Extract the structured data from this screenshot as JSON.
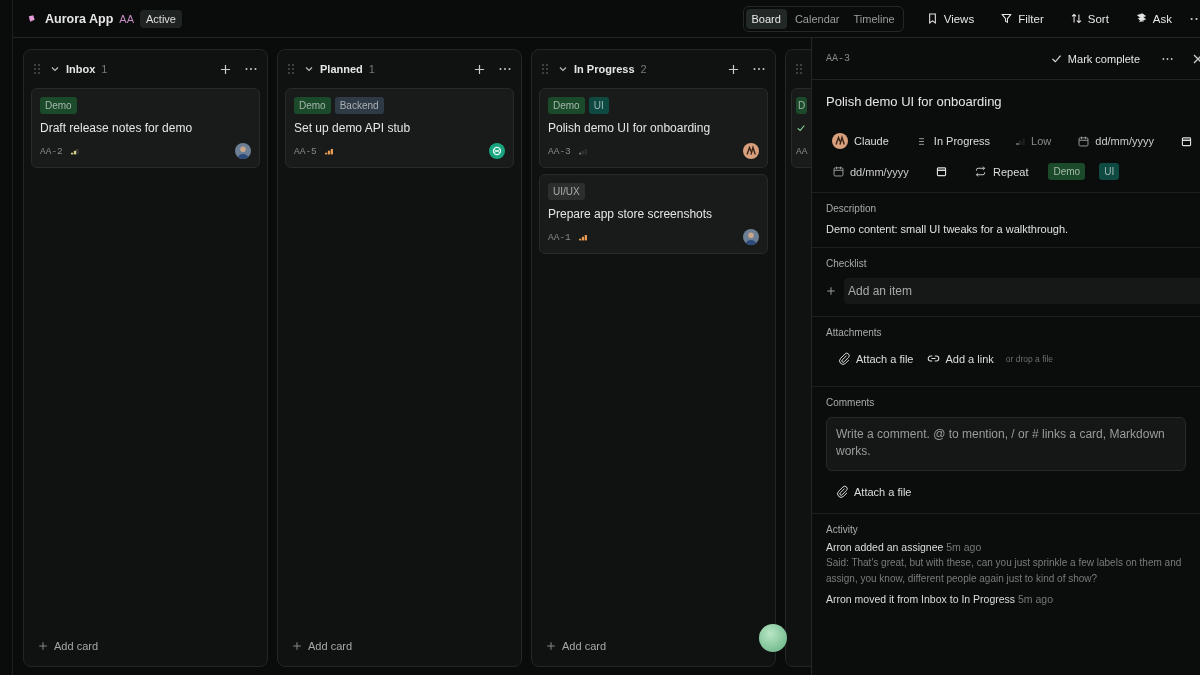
{
  "app": {
    "name": "Aurora App",
    "initials": "AA",
    "status": "Active"
  },
  "view_tabs": [
    {
      "label": "Board",
      "selected": true
    },
    {
      "label": "Calendar",
      "selected": false
    },
    {
      "label": "Timeline",
      "selected": false
    }
  ],
  "toolbar": [
    {
      "label": "Views"
    },
    {
      "label": "Filter"
    },
    {
      "label": "Sort"
    },
    {
      "label": "Ask"
    }
  ],
  "columns": [
    {
      "title": "Inbox",
      "count": "1",
      "add_label": "Add card",
      "cards": [
        {
          "tags": [
            {
              "label": "Demo",
              "color": "#1b4a2b"
            }
          ],
          "title": "Draft release notes for demo",
          "id": "AA-2",
          "priority": {
            "kind": "medium"
          },
          "avatar": {
            "kind": "person"
          }
        }
      ]
    },
    {
      "title": "Planned",
      "count": "1",
      "add_label": "Add card",
      "cards": [
        {
          "tags": [
            {
              "label": "Demo",
              "color": "#1b4a2b"
            },
            {
              "label": "Backend",
              "color": "#2e3a46"
            }
          ],
          "title": "Set up demo API stub",
          "id": "AA-5",
          "priority": {
            "kind": "high"
          },
          "avatar": {
            "kind": "bot"
          }
        }
      ]
    },
    {
      "title": "In Progress",
      "count": "2",
      "add_label": "Add card",
      "cards": [
        {
          "tags": [
            {
              "label": "Demo",
              "color": "#1b4a2b"
            },
            {
              "label": "UI",
              "color": "#0f4a42"
            }
          ],
          "title": "Polish demo UI for onboarding",
          "id": "AA-3",
          "priority": {
            "kind": "low"
          },
          "avatar": {
            "kind": "claude"
          }
        },
        {
          "tags": [
            {
              "label": "UI/UX",
              "color": "#2c2e2e"
            }
          ],
          "title": "Prepare app store screenshots",
          "id": "AA-1",
          "priority": {
            "kind": "high"
          },
          "avatar": {
            "kind": "person"
          }
        }
      ]
    },
    {
      "cards": [
        {
          "tags": [
            {
              "label": "D",
              "color": "#1b4a2b"
            }
          ],
          "done": true,
          "id": "AA"
        }
      ]
    }
  ],
  "detail": {
    "id": "AA-3",
    "complete_label": "Mark complete",
    "title": "Polish demo UI for onboarding",
    "assignee": {
      "name": "Claude",
      "kind": "claude"
    },
    "status": "In Progress",
    "priority": {
      "label": "Low",
      "kind": "low"
    },
    "due_placeholder": "dd/mm/yyyy",
    "start_placeholder": "dd/mm/yyyy",
    "repeat": "Repeat",
    "tags": [
      {
        "label": "Demo",
        "color": "#1b4a2b"
      },
      {
        "label": "UI",
        "color": "#0f4a42"
      }
    ],
    "description": {
      "heading": "Description",
      "text": "Demo content: small UI tweaks for a walkthrough."
    },
    "checklist": {
      "heading": "Checklist",
      "placeholder": "Add an item"
    },
    "attachments": {
      "heading": "Attachments",
      "actions": [
        {
          "label": "Attach a file"
        },
        {
          "label": "Add a link"
        }
      ],
      "hint": "or drop a file"
    },
    "comments": {
      "heading": "Comments",
      "placeholder": "Write a comment. @ to mention, / or # links a card, Markdown works.",
      "attach": "Attach a file"
    },
    "activity": {
      "heading": "Activity",
      "entries": [
        {
          "text": "Arron added an assignee",
          "time": "5m ago",
          "quote": "Said: That's great, but with these, can you just sprinkle a few labels on them and assign, you know, different people again just to kind of show?"
        },
        {
          "text": "Arron moved it from Inbox to In Progress",
          "time": "5m ago"
        }
      ]
    }
  }
}
